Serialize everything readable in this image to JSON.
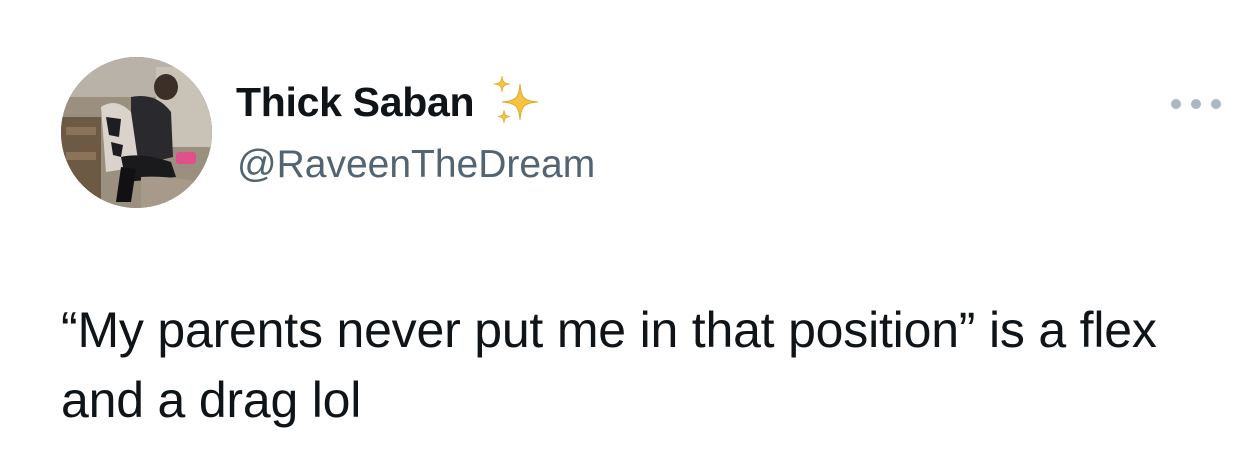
{
  "author": {
    "display_name": "Thick Saban",
    "handle": "@RaveenTheDream",
    "badge_icon": "sparkles-icon",
    "avatar_description_icon": "profile-photo"
  },
  "menu": {
    "icon": "more-options-icon"
  },
  "tweet": {
    "text": "“My parents never put me in that position” is a flex and a drag lol"
  },
  "colors": {
    "text_primary": "#0f1419",
    "text_secondary": "#536471",
    "more_dots": "#aab8c2",
    "sparkle": "#f5c542"
  }
}
